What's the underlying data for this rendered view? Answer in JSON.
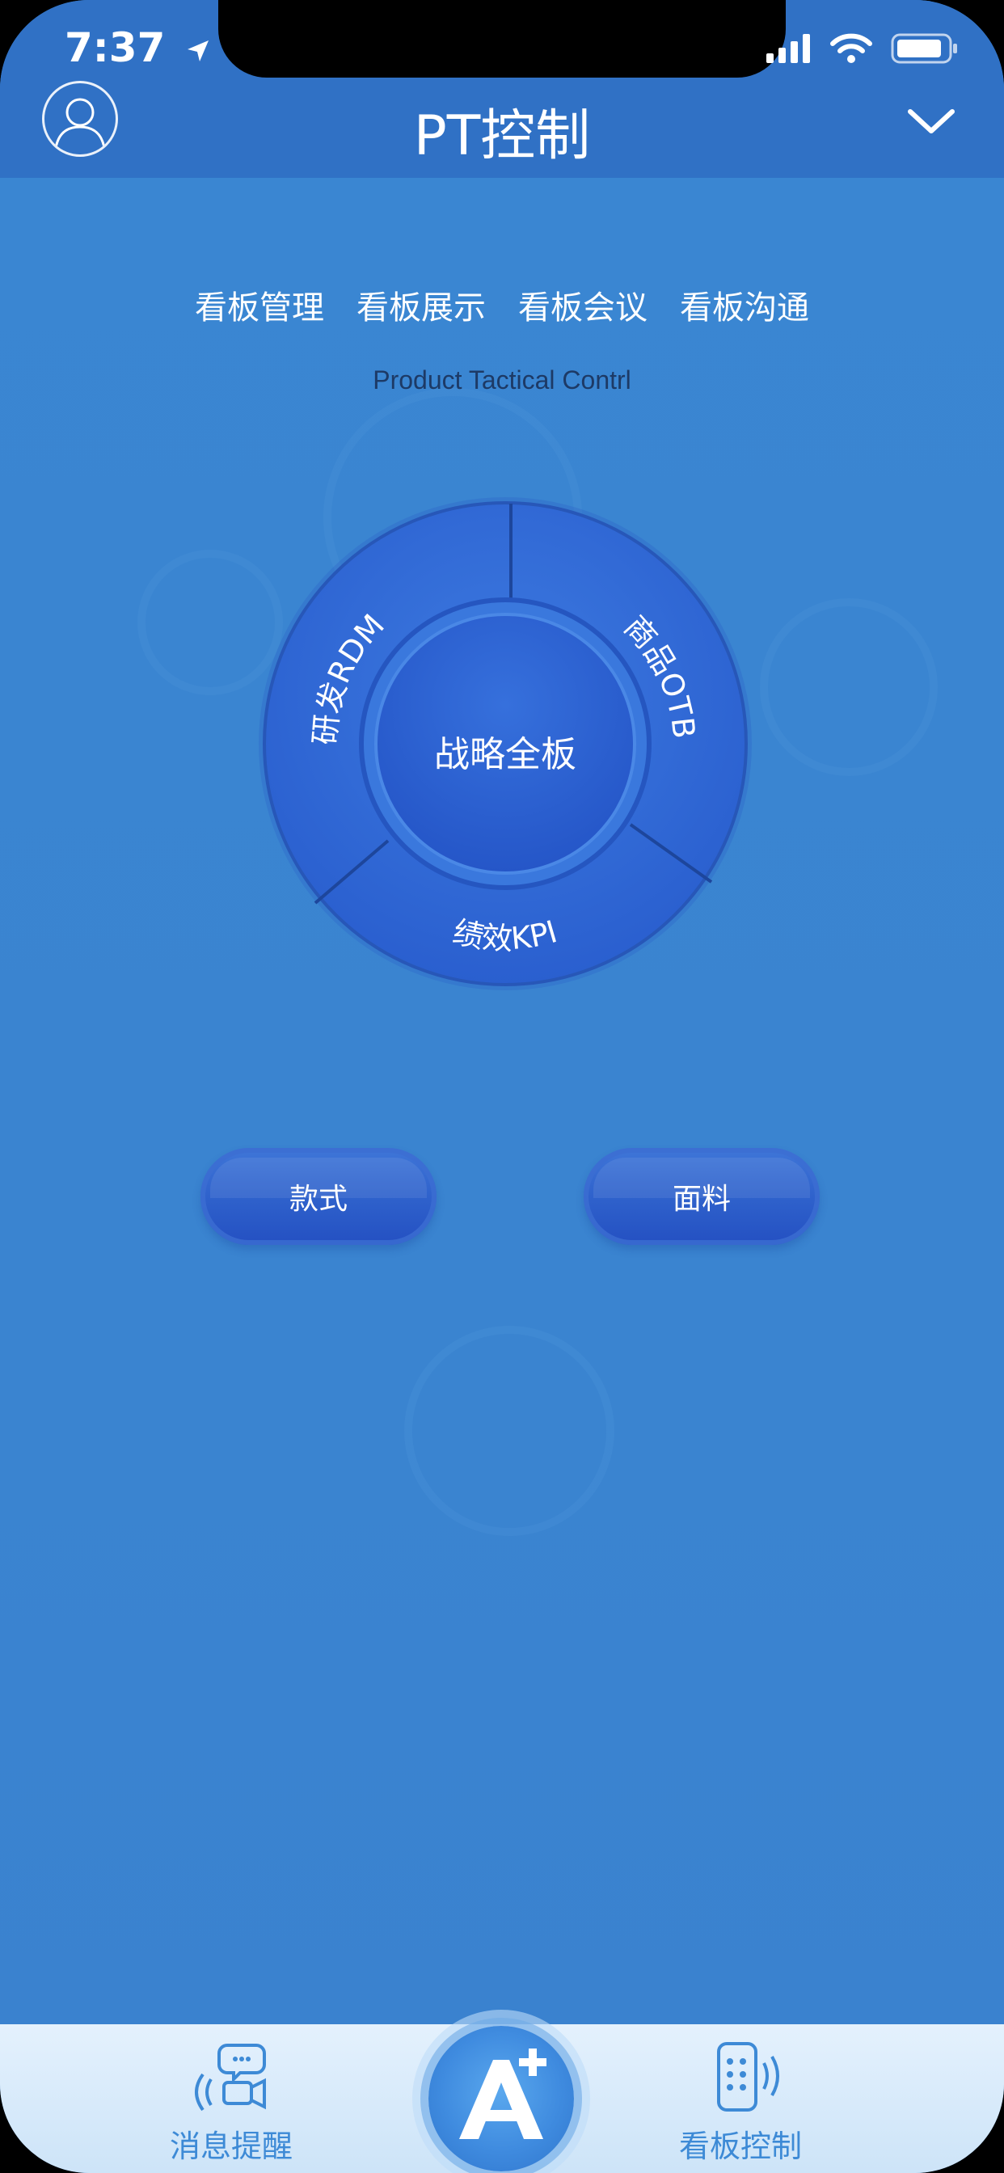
{
  "status_bar": {
    "time": "7:37"
  },
  "header": {
    "title": "PT控制"
  },
  "top_menu": {
    "items": [
      "看板管理",
      "看板展示",
      "看板会议",
      "看板沟通"
    ]
  },
  "subtitle": "Product Tactical Contrl",
  "wheel": {
    "center": "战略全板",
    "segments": {
      "left": "研发RDM",
      "right": "商品OTB",
      "bottom": "绩效KPI"
    }
  },
  "buttons": {
    "style": "款式",
    "fabric": "面料"
  },
  "tabbar": {
    "messages": "消息提醒",
    "board_control": "看板控制"
  },
  "colors": {
    "background": "#3a84d0",
    "navbar": "#3071c5",
    "tab_text": "#3d8ad6"
  }
}
